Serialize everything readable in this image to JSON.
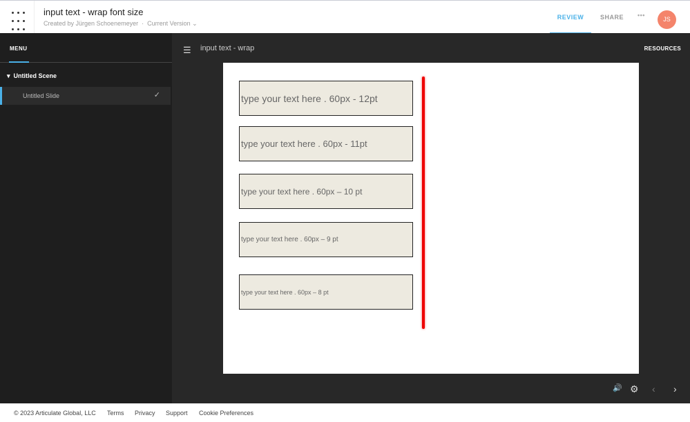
{
  "header": {
    "title": "input text - wrap font size",
    "created_by": "Created by Jürgen Schoenemeyer",
    "version": "Current Version",
    "tabs": [
      "REVIEW",
      "SHARE"
    ],
    "more": "•••",
    "avatar": "JS"
  },
  "sidebar": {
    "menu_label": "MENU",
    "scene": "Untitled Scene",
    "slide": "Untitled Slide"
  },
  "player": {
    "title": "input text - wrap",
    "resources": "RESOURCES"
  },
  "slide": {
    "inputs": [
      "type your text here . 60px - 12pt",
      "type your text here . 60px - 11pt",
      "type your text here . 60px – 10 pt",
      "type your text here . 60px – 9 pt",
      "type your text here . 60px – 8 pt"
    ]
  },
  "footer": {
    "copyright": "© 2023 Articulate Global, LLC",
    "links": [
      "Terms",
      "Privacy",
      "Support",
      "Cookie Preferences"
    ]
  }
}
